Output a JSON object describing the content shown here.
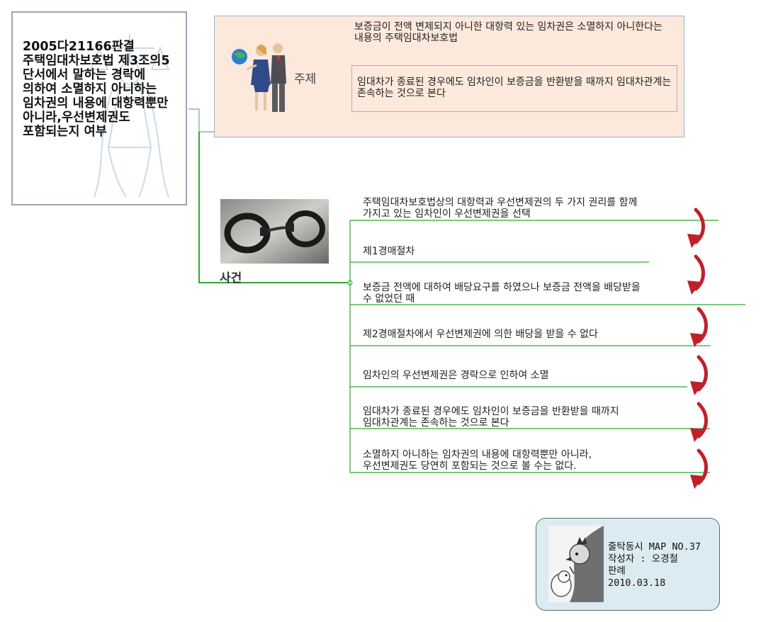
{
  "root": {
    "title": "2005다21166판결 주택임대차보호법 제3조의5 단서에서 말하는 경락에 의하여 소멸하지 아니하는 임차권의 내용에 대항력뿐만 아니라,우선변제권도 포함되는지 여부"
  },
  "topic": {
    "label": "주제",
    "text1": "보증금이 전액 변제되지 아니한 대항력 있는 임차권은 소멸하지 아니한다는 내용의 주택임대차보호법",
    "text2": "임대차가 종료된 경우에도 임차인이 보증금을 반환받을 때까지 임대차관계는 존속하는 것으로 본다"
  },
  "case": {
    "label": "사건",
    "steps": [
      {
        "line1": "주택임대차보호법상의 대항력과 우선변제권의 두 가지 권리를 함께",
        "line2": "가지고 있는 임차인이 우선변제권을 선택"
      },
      {
        "line1": "제1경매절차",
        "line2": ""
      },
      {
        "line1": "보증금 전액에 대하여 배당요구를 하였으나 보증금 전액을 배당받을",
        "line2": "수 없었던 때"
      },
      {
        "line1": "제2경매절차에서 우선변제권에 의한 배당을 받을 수 없다",
        "line2": ""
      },
      {
        "line1": "임차인의 우선변제권은 경락으로 인하여 소멸",
        "line2": ""
      },
      {
        "line1": "임대차가 종료된 경우에도 임차인이 보증금을 반환받을 때까지",
        "line2": "임대차관계는 존속하는 것으로 본다"
      },
      {
        "line1": "소멸하지 아니하는 임차권의 내용에 대항력뿐만 아니라,",
        "line2": "우선변제권도 당연히 포함되는 것으로 볼 수는 없다."
      }
    ]
  },
  "info": {
    "line1": "줄탁동시 MAP NO.37",
    "line2": "작성자 : 오경철",
    "line3": "판례",
    "line4": "2010.03.18"
  },
  "colors": {
    "connector": "#2fa82f",
    "topic_bg": "#fde8dc",
    "arrow": "#c0202a",
    "info_bg": "#dcebf2"
  }
}
